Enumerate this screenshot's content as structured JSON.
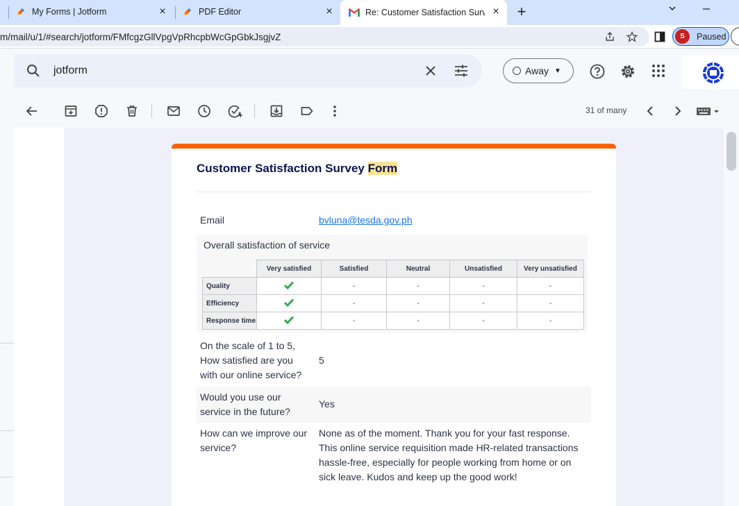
{
  "browser": {
    "tabs": [
      {
        "title": "My Forms | Jotform",
        "active": false
      },
      {
        "title": "PDF Editor",
        "active": false
      },
      {
        "title": "Re: Customer Satisfaction Survey",
        "active": true
      }
    ],
    "url": "m/mail/u/1/#search/jotform/FMfcgzGllVpgVpRhcpbWcGpGbkJsgjvZ",
    "profile_initial": "S",
    "profile_status": "Paused"
  },
  "gmail": {
    "search_query": "jotform",
    "status": "Away",
    "pager": "31 of many"
  },
  "form": {
    "title_plain": "Customer Satisfaction Survey ",
    "title_highlight": "Form",
    "email_label": "Email",
    "email_value": "bvluna@tesda.gov.ph",
    "overall_label": "Overall satisfaction of service",
    "matrix": {
      "columns": [
        "Very satisfied",
        "Satisfied",
        "Neutral",
        "Unsatisfied",
        "Very unsatisfied"
      ],
      "rows": [
        {
          "label": "Quality",
          "cells": [
            "check",
            "-",
            "-",
            "-",
            "-"
          ]
        },
        {
          "label": "Efficiency",
          "cells": [
            "check",
            "-",
            "-",
            "-",
            "-"
          ]
        },
        {
          "label": "Response time",
          "cells": [
            "check",
            "-",
            "-",
            "-",
            "-"
          ]
        }
      ]
    },
    "scale_label_1": "On the scale of 1 to 5,",
    "scale_label_2": "How satisfied are you",
    "scale_label_3": "with our online service?",
    "scale_value": "5",
    "future_label_1": "Would you use our",
    "future_label_2": "service in the future?",
    "future_value": "Yes",
    "improve_label_1": "How can we improve our",
    "improve_label_2": "service?",
    "improve_value_1": "None as of the moment. Thank you for your fast response.",
    "improve_value_2": "This online service requisition made HR-related transactions",
    "improve_value_3": "hassle-free, especially for people working from home or on",
    "improve_value_4": "sick leave. Kudos and keep up the good work!"
  },
  "colors": {
    "accent_orange": "#ff6100",
    "check_green": "#34a853",
    "title_navy": "#0a1551"
  }
}
